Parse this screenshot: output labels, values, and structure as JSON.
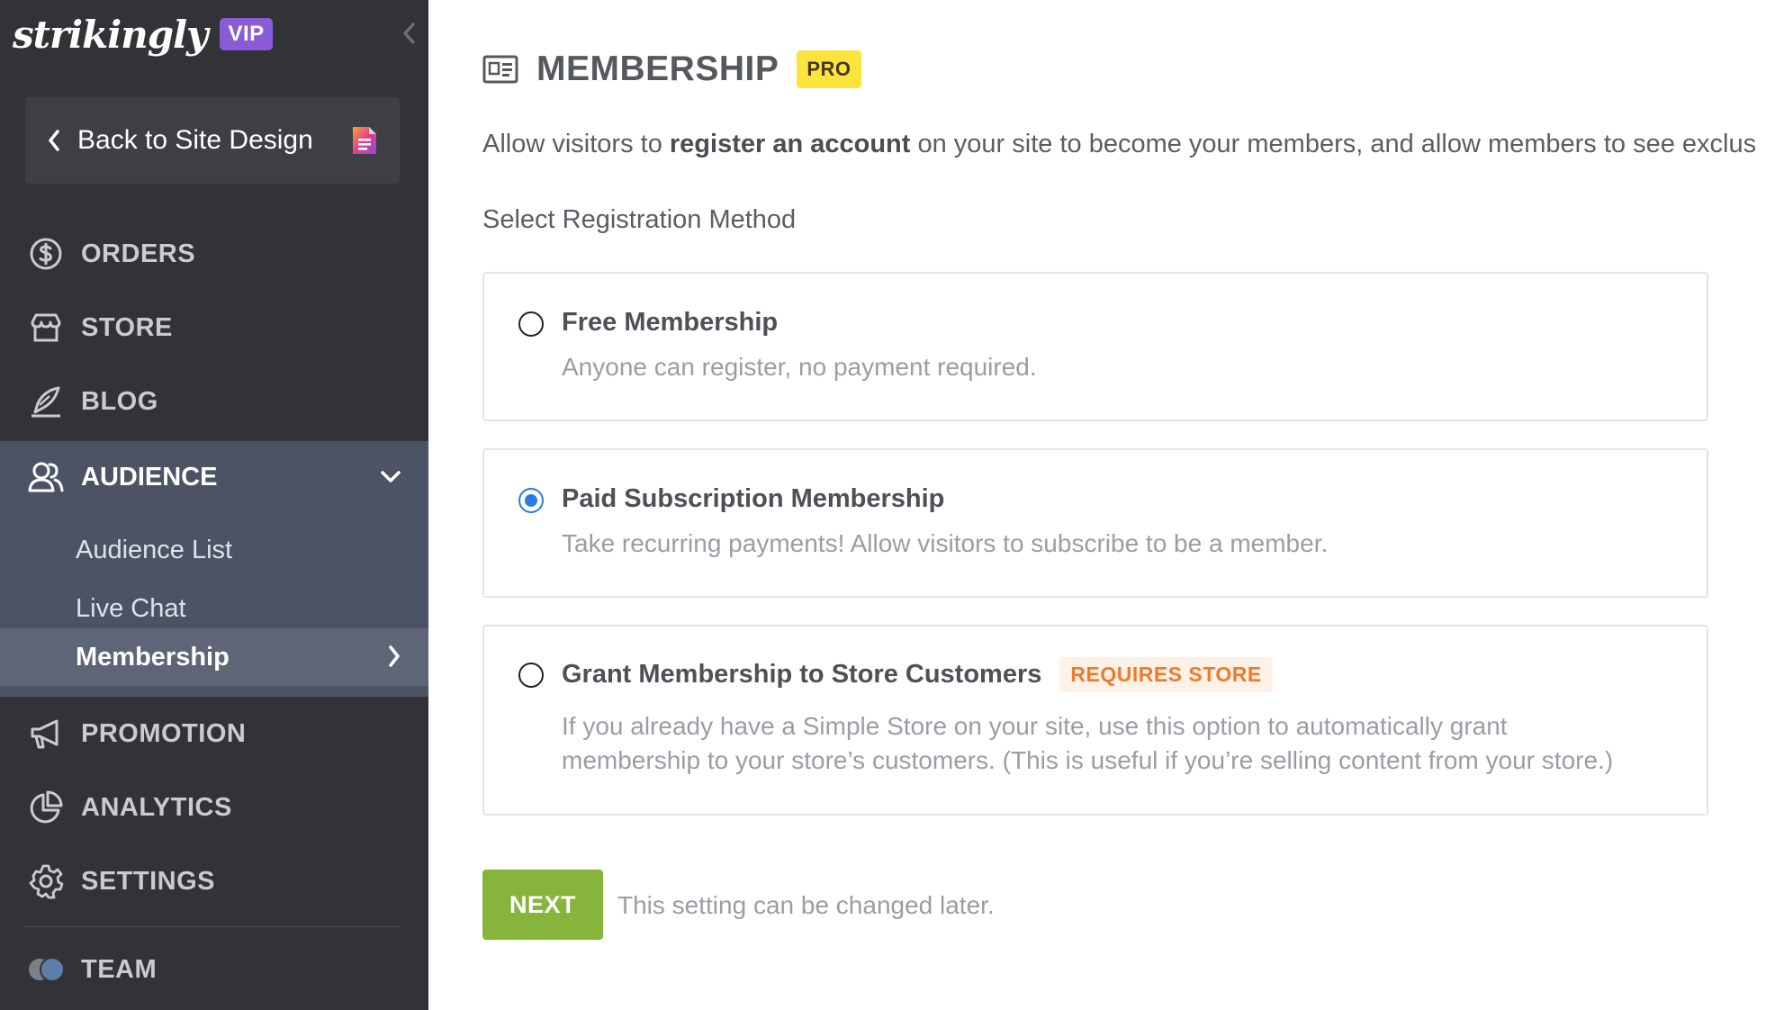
{
  "brand": {
    "logo": "strikingly",
    "badge": "VIP"
  },
  "sidebar": {
    "back_label": "Back to Site Design",
    "nav": [
      {
        "label": "ORDERS",
        "icon": "dollar-circle-icon"
      },
      {
        "label": "STORE",
        "icon": "storefront-icon"
      },
      {
        "label": "BLOG",
        "icon": "quill-icon"
      }
    ],
    "audience": {
      "label": "AUDIENCE",
      "icon": "users-icon",
      "expanded": true,
      "items": [
        {
          "label": "Audience List",
          "active": false
        },
        {
          "label": "Live Chat",
          "active": false
        },
        {
          "label": "Membership",
          "active": true
        }
      ]
    },
    "nav_bottom": [
      {
        "label": "PROMOTION",
        "icon": "megaphone-icon"
      },
      {
        "label": "ANALYTICS",
        "icon": "pie-chart-icon"
      },
      {
        "label": "SETTINGS",
        "icon": "gear-icon"
      }
    ],
    "team": {
      "label": "TEAM"
    }
  },
  "main": {
    "title": "MEMBERSHIP",
    "title_badge": "PRO",
    "description_pre": "Allow visitors to ",
    "description_bold": "register an account",
    "description_post": " on your site to become your members, and allow members to see exclus",
    "section_label": "Select Registration Method",
    "options": [
      {
        "title": "Free Membership",
        "description": "Anyone can register, no payment required.",
        "selected": false
      },
      {
        "title": "Paid Subscription Membership",
        "description": "Take recurring payments! Allow visitors to subscribe to be a member.",
        "selected": true
      },
      {
        "title": "Grant Membership to Store Customers",
        "badge": "REQUIRES STORE",
        "description_line1": "If you already have a Simple Store on your site, use this option to automatically grant",
        "description_line2": "membership to your store’s customers. (This is useful if you’re selling content from your store.)",
        "selected": false
      }
    ],
    "next_label": "NEXT",
    "hint": "This setting can be changed later."
  },
  "colors": {
    "sidebar_bg": "#323337",
    "audience_bg": "#4c5364",
    "active_item_bg": "#5e6577",
    "vip": "#8a5bd6",
    "pro": "#fde43c",
    "radio_selected": "#2a7de1",
    "next_button": "#87b53b",
    "store_badge_text": "#f07a2a"
  }
}
